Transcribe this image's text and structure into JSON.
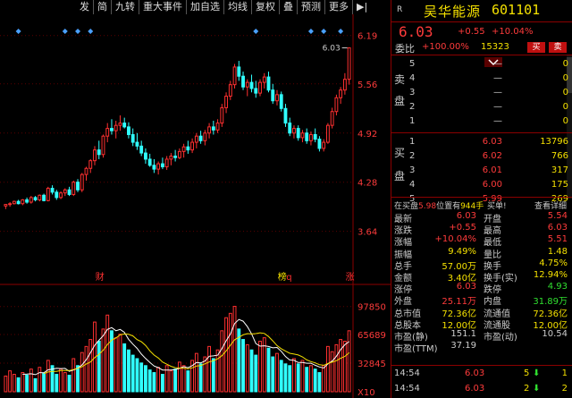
{
  "toolbar": {
    "items": [
      "发",
      "简",
      "九转",
      "重大事件",
      "加自选",
      "均线",
      "复权",
      "叠",
      "预测",
      "更多",
      "▶|"
    ]
  },
  "chart_data": {
    "type": "candlestick",
    "price_axis": {
      "ticks": [
        "6.19",
        "5.56",
        "4.92",
        "4.28",
        "3.64"
      ],
      "ylim": [
        3.1,
        6.28
      ]
    },
    "volume_axis": {
      "ticks": [
        "97850",
        "65689",
        "32845"
      ],
      "unit": "X10",
      "ylim": [
        0,
        115000
      ]
    },
    "high_label": "6.03",
    "event_markers": [
      "财",
      "榜",
      "q",
      "涨"
    ],
    "candles": [
      [
        3.97,
        3.99,
        3.93,
        3.99
      ],
      [
        3.99,
        4.02,
        3.96,
        4.0
      ],
      [
        4.0,
        4.04,
        3.99,
        4.03
      ],
      [
        4.03,
        4.05,
        3.99,
        4.0
      ],
      [
        4.0,
        4.06,
        3.98,
        4.05
      ],
      [
        4.05,
        4.08,
        4.0,
        4.02
      ],
      [
        4.02,
        4.1,
        4.0,
        4.08
      ],
      [
        4.08,
        4.1,
        4.03,
        4.05
      ],
      [
        4.05,
        4.12,
        4.03,
        4.11
      ],
      [
        4.11,
        4.13,
        4.03,
        4.04
      ],
      [
        4.04,
        4.22,
        4.03,
        4.2
      ],
      [
        4.2,
        4.24,
        4.12,
        4.15
      ],
      [
        4.15,
        4.18,
        4.05,
        4.08
      ],
      [
        4.08,
        4.16,
        4.06,
        4.14
      ],
      [
        4.14,
        4.2,
        4.1,
        4.18
      ],
      [
        4.18,
        4.22,
        4.1,
        4.12
      ],
      [
        4.12,
        4.3,
        4.1,
        4.28
      ],
      [
        4.28,
        4.32,
        4.15,
        4.18
      ],
      [
        4.18,
        4.4,
        4.15,
        4.38
      ],
      [
        4.38,
        4.48,
        4.3,
        4.46
      ],
      [
        4.46,
        4.58,
        4.4,
        4.56
      ],
      [
        4.56,
        4.75,
        4.5,
        4.7
      ],
      [
        4.7,
        4.82,
        4.58,
        4.64
      ],
      [
        4.64,
        4.9,
        4.6,
        4.88
      ],
      [
        4.88,
        5.05,
        4.8,
        4.98
      ],
      [
        4.98,
        5.1,
        4.9,
        4.95
      ],
      [
        4.95,
        5.08,
        4.85,
        5.02
      ],
      [
        5.02,
        5.15,
        4.95,
        5.05
      ],
      [
        5.05,
        5.12,
        4.98,
        5.0
      ],
      [
        5.0,
        5.06,
        4.85,
        4.9
      ],
      [
        4.9,
        4.98,
        4.75,
        4.8
      ],
      [
        4.8,
        4.92,
        4.7,
        4.75
      ],
      [
        4.75,
        4.82,
        4.62,
        4.66
      ],
      [
        4.66,
        4.72,
        4.52,
        4.58
      ],
      [
        4.58,
        4.65,
        4.48,
        4.5
      ],
      [
        4.5,
        4.58,
        4.4,
        4.45
      ],
      [
        4.45,
        4.55,
        4.38,
        4.52
      ],
      [
        4.52,
        4.6,
        4.45,
        4.48
      ],
      [
        4.48,
        4.62,
        4.44,
        4.58
      ],
      [
        4.58,
        4.66,
        4.5,
        4.62
      ],
      [
        4.62,
        4.7,
        4.55,
        4.6
      ],
      [
        4.6,
        4.72,
        4.58,
        4.68
      ],
      [
        4.68,
        4.78,
        4.6,
        4.74
      ],
      [
        4.74,
        4.82,
        4.65,
        4.7
      ],
      [
        4.7,
        4.85,
        4.66,
        4.8
      ],
      [
        4.8,
        4.92,
        4.72,
        4.88
      ],
      [
        4.88,
        4.95,
        4.78,
        4.82
      ],
      [
        4.82,
        4.96,
        4.76,
        4.92
      ],
      [
        4.92,
        5.05,
        4.85,
        5.0
      ],
      [
        5.0,
        5.08,
        4.9,
        4.96
      ],
      [
        4.96,
        5.1,
        4.92,
        5.05
      ],
      [
        5.05,
        5.3,
        5.0,
        5.25
      ],
      [
        5.25,
        5.45,
        5.18,
        5.4
      ],
      [
        5.4,
        5.6,
        5.35,
        5.55
      ],
      [
        5.55,
        5.82,
        5.5,
        5.78
      ],
      [
        5.78,
        5.86,
        5.6,
        5.66
      ],
      [
        5.66,
        5.72,
        5.48,
        5.52
      ],
      [
        5.52,
        5.62,
        5.4,
        5.58
      ],
      [
        5.58,
        5.68,
        5.45,
        5.5
      ],
      [
        5.5,
        5.6,
        5.38,
        5.44
      ],
      [
        5.44,
        5.62,
        5.4,
        5.58
      ],
      [
        5.58,
        5.7,
        5.5,
        5.65
      ],
      [
        5.65,
        5.72,
        5.45,
        5.48
      ],
      [
        5.48,
        5.56,
        5.3,
        5.34
      ],
      [
        5.34,
        5.48,
        5.28,
        5.42
      ],
      [
        5.42,
        5.46,
        5.2,
        5.24
      ],
      [
        5.24,
        5.3,
        5.0,
        5.05
      ],
      [
        5.05,
        5.12,
        4.88,
        4.92
      ],
      [
        4.92,
        5.02,
        4.85,
        4.98
      ],
      [
        4.98,
        5.02,
        4.82,
        4.86
      ],
      [
        4.86,
        4.96,
        4.8,
        4.92
      ],
      [
        4.92,
        4.98,
        4.78,
        4.82
      ],
      [
        4.82,
        4.94,
        4.76,
        4.9
      ],
      [
        4.9,
        4.98,
        4.8,
        4.84
      ],
      [
        4.84,
        4.88,
        4.68,
        4.72
      ],
      [
        4.72,
        4.84,
        4.68,
        4.8
      ],
      [
        4.8,
        5.05,
        4.78,
        5.02
      ],
      [
        5.02,
        5.25,
        4.98,
        5.2
      ],
      [
        5.2,
        5.42,
        5.15,
        5.38
      ],
      [
        5.38,
        5.52,
        5.3,
        5.48
      ],
      [
        5.48,
        5.7,
        5.42,
        5.62
      ],
      [
        5.62,
        6.03,
        5.55,
        6.03
      ]
    ],
    "volumes": [
      18,
      24,
      20,
      16,
      22,
      19,
      26,
      15,
      28,
      21,
      36,
      30,
      20,
      26,
      22,
      19,
      38,
      30,
      45,
      52,
      60,
      80,
      58,
      72,
      88,
      70,
      62,
      66,
      55,
      48,
      42,
      38,
      33,
      30,
      25,
      22,
      28,
      20,
      30,
      24,
      26,
      34,
      30,
      24,
      36,
      44,
      32,
      40,
      52,
      38,
      48,
      70,
      85,
      90,
      98,
      72,
      60,
      54,
      48,
      42,
      58,
      62,
      50,
      40,
      44,
      36,
      32,
      30,
      38,
      32,
      36,
      28,
      30,
      26,
      22,
      30,
      52,
      46,
      54,
      60,
      58,
      70
    ]
  },
  "stock": {
    "r_tag": "R",
    "name": "吴华能源",
    "code": "601101",
    "price": "6.03",
    "change": "+0.55",
    "pct": "+10.04%",
    "weibi_label": "委比",
    "weibi": "+100.00%",
    "weicha": "15323",
    "buy_btn": "买",
    "sell_btn": "卖"
  },
  "orderbook": {
    "sell_side_label": "卖",
    "sell_side_label2": "盘",
    "buy_side_label": "买",
    "buy_side_label2": "盘",
    "asks": [
      {
        "n": "5",
        "price": "—",
        "vol": "0"
      },
      {
        "n": "4",
        "price": "—",
        "vol": "0"
      },
      {
        "n": "3",
        "price": "—",
        "vol": "0"
      },
      {
        "n": "2",
        "price": "—",
        "vol": "0"
      },
      {
        "n": "1",
        "price": "—",
        "vol": "0"
      }
    ],
    "bids": [
      {
        "n": "1",
        "price": "6.03",
        "vol": "13796"
      },
      {
        "n": "2",
        "price": "6.02",
        "vol": "766"
      },
      {
        "n": "3",
        "price": "6.01",
        "vol": "317"
      },
      {
        "n": "4",
        "price": "6.00",
        "vol": "175"
      },
      {
        "n": "5",
        "price": "5.99",
        "vol": "269"
      }
    ]
  },
  "info_bar": {
    "prefix": "在买盘",
    "price": "5.98",
    "mid": "位置有",
    "qty": "944手",
    "buy1": "买单!",
    "detail": "查看详细"
  },
  "stats": [
    {
      "l1": "最新",
      "v1": "6.03",
      "c1": "#ff3b3b",
      "l2": "开盘",
      "v2": "5.54",
      "c2": "#ff3b3b"
    },
    {
      "l1": "涨跌",
      "v1": "+0.55",
      "c1": "#ff3b3b",
      "l2": "最高",
      "v2": "6.03",
      "c2": "#ff3b3b"
    },
    {
      "l1": "涨幅",
      "v1": "+10.04%",
      "c1": "#ff3b3b",
      "l2": "最低",
      "v2": "5.51",
      "c2": "#ff3b3b"
    },
    {
      "l1": "振幅",
      "v1": "9.49%",
      "c1": "#f4e000",
      "l2": "量比",
      "v2": "1.48",
      "c2": "#f4e000"
    },
    {
      "l1": "总手",
      "v1": "57.00万",
      "c1": "#f4e000",
      "l2": "换手",
      "v2": "4.75%",
      "c2": "#f4e000"
    },
    {
      "l1": "金额",
      "v1": "3.40亿",
      "c1": "#f4e000",
      "l2": "换手(实)",
      "v2": "12.94%",
      "c2": "#f4e000"
    },
    {
      "l1": "涨停",
      "v1": "6.03",
      "c1": "#ff3b3b",
      "l2": "跌停",
      "v2": "4.93",
      "c2": "#30e030"
    },
    {
      "l1": "外盘",
      "v1": "25.11万",
      "c1": "#ff3b3b",
      "l2": "内盘",
      "v2": "31.89万",
      "c2": "#30e030"
    },
    {
      "l1": "总市值",
      "v1": "72.36亿",
      "c1": "#f4e000",
      "l2": "流通值",
      "v2": "72.36亿",
      "c2": "#f4e000"
    },
    {
      "l1": "总股本",
      "v1": "12.00亿",
      "c1": "#f4e000",
      "l2": "流通股",
      "v2": "12.00亿",
      "c2": "#f4e000"
    },
    {
      "l1": "市盈(静)",
      "v1": "151.1",
      "c1": "#ccc",
      "l2": "市盈(动)",
      "v2": "10.54",
      "c2": "#ccc"
    },
    {
      "l1": "市盈(TTM)",
      "v1": "37.19",
      "c1": "#ccc",
      "l2": "",
      "v2": "",
      "c2": "#ccc"
    }
  ],
  "trades": [
    {
      "time": "14:54",
      "price": "6.03",
      "vol": "5",
      "arrow": "⬇",
      "num": "1"
    },
    {
      "time": "14:54",
      "price": "6.03",
      "vol": "2",
      "arrow": "⬇",
      "num": "2"
    }
  ]
}
